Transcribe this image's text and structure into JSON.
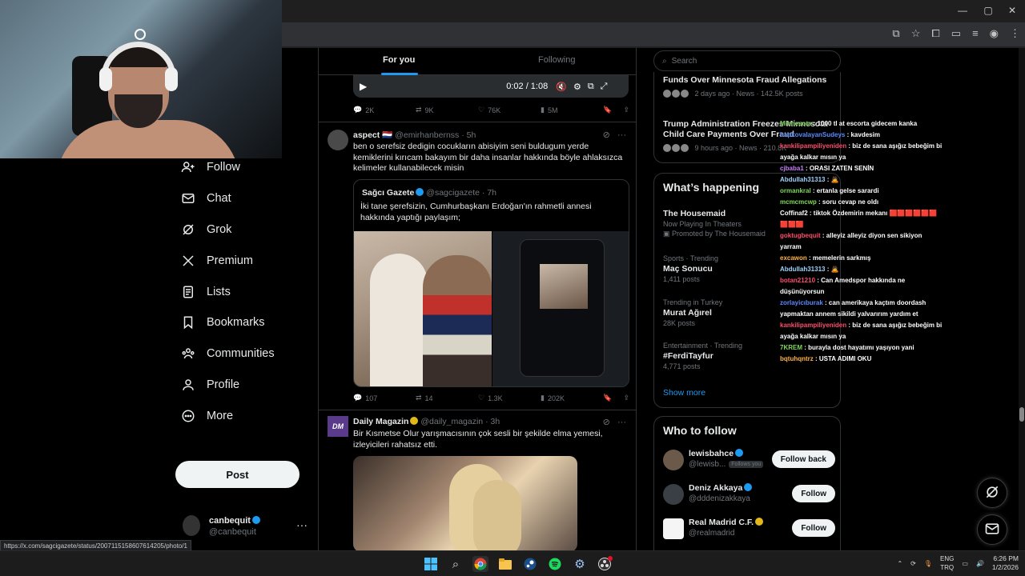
{
  "browser": {
    "title_icons": [
      "minimize-icon",
      "maximize-icon",
      "close-icon"
    ]
  },
  "status_url": "https://x.com/sagcigazete/status/2007115158607614205/photo/1",
  "sidebar": {
    "items": [
      {
        "label": "Follow",
        "icon": "add-person-icon"
      },
      {
        "label": "Chat",
        "icon": "mail-icon"
      },
      {
        "label": "Grok",
        "icon": "grok-icon"
      },
      {
        "label": "Premium",
        "icon": "x-logo-icon"
      },
      {
        "label": "Lists",
        "icon": "list-icon"
      },
      {
        "label": "Bookmarks",
        "icon": "bookmark-icon"
      },
      {
        "label": "Communities",
        "icon": "communities-icon"
      },
      {
        "label": "Profile",
        "icon": "person-icon"
      },
      {
        "label": "More",
        "icon": "more-circle-icon"
      }
    ],
    "post_label": "Post",
    "account": {
      "name": "canbequit",
      "handle": "@canbequit"
    }
  },
  "timeline": {
    "tabs": {
      "for_you": "For you",
      "following": "Following"
    },
    "video": {
      "time": "0:02 / 1:08"
    },
    "tweet0_actions": {
      "replies": "2K",
      "reposts": "9K",
      "likes": "76K",
      "views": "5M"
    },
    "tweet1": {
      "name": "aspect",
      "flag": "🇳🇱",
      "handle": "@emirhanbernss",
      "time": "· 5h",
      "text": "ben o serefsiz dedigin cocukların abisiyim seni buldugum yerde kemiklerini kırıcam bakayım bir daha insanlar hakkında böyle ahlaksızca kelimeler kullanabilecek misin",
      "quote": {
        "name": "Sağcı Gazete",
        "handle": "@sagcigazete",
        "time": "· 7h",
        "text": "İki tane şerefsizin, Cumhurbaşkanı Erdoğan'ın rahmetli annesi hakkında yaptığı paylaşım;"
      },
      "actions": {
        "replies": "107",
        "reposts": "14",
        "likes": "1.3K",
        "views": "202K"
      }
    },
    "tweet2": {
      "avatar": "DM",
      "name": "Daily Magazin",
      "handle": "@daily_magazin",
      "time": "· 3h",
      "text": "Bir Kısmetse Olur yarışmacısının çok sesli bir şekilde elma yemesi, izleyicileri rahatsız etti."
    }
  },
  "right": {
    "search_placeholder": "Search",
    "news": [
      {
        "title": "Funds Over Minnesota Fraud Allegations",
        "meta": "2 days ago · News · 142.5K posts"
      },
      {
        "title": "Trump Administration Freezes Minnesota Child Care Payments Over Fraud",
        "meta": "9 hours ago · News · 210.8K"
      }
    ],
    "happening": {
      "title": "What’s happening",
      "trends": [
        {
          "context": "",
          "title": "The Housemaid",
          "sub": "Now Playing In Theaters",
          "promo": "Promoted by The Housemaid"
        },
        {
          "context": "Sports · Trending",
          "title": "Maç Sonucu",
          "sub": "1,411 posts"
        },
        {
          "context": "Trending in Turkey",
          "title": "Murat Ağırel",
          "sub": "28K posts"
        },
        {
          "context": "Entertainment · Trending",
          "title": "#FerdiTayfur",
          "sub": "4,771 posts"
        }
      ],
      "show_more": "Show more"
    },
    "who_to_follow": {
      "title": "Who to follow",
      "users": [
        {
          "name": "lewisbahce",
          "handle": "@lewisb...",
          "badge": "Follows you",
          "button": "Follow back"
        },
        {
          "name": "Deniz Akkaya",
          "handle": "@dddenizakkaya",
          "button": "Follow"
        },
        {
          "name": "Real Madrid C.F.",
          "handle": "@realmadrid",
          "button": "Follow"
        }
      ]
    }
  },
  "chat": [
    {
      "user": "Minnesota",
      "msg": "1000 tl at escorta gidecem kanka",
      "color": "#7ed957"
    },
    {
      "user": "hapkovalayanSudeys",
      "msg": "kavdesim",
      "color": "#5b8bff"
    },
    {
      "user": "kankilipampiliyeniden",
      "msg": "biz de sana aşığız bebeğim bi ayağa kalkar mısın ya",
      "color": "#ff4d6d"
    },
    {
      "user": "cjbaba1",
      "msg": "ORASI ZATEN SENİN",
      "color": "#c77dff"
    },
    {
      "user": "Abdullah31313",
      "msg": "🙇",
      "color": "#9fd3ff"
    },
    {
      "user": "ormankral",
      "msg": "ertanla gelse sarardi",
      "color": "#7ed957"
    },
    {
      "user": "mcmcmcwp",
      "msg": "soru cevap ne oldı",
      "color": "#7ed957"
    },
    {
      "user": "Coffinaf2",
      "msg": "tiktok Özdemirin mekanı 🟥🟥🟥🟥🟥🟥🟥🟥🟥",
      "color": "#ffffff"
    },
    {
      "user": "goktugbequit",
      "msg": "alleyiz alleyiz diyon sen sikiyon yarram",
      "color": "#ff4d6d"
    },
    {
      "user": "excawon",
      "msg": "memelerin sarkmış",
      "color": "#ffb347"
    },
    {
      "user": "Abdullah31313",
      "msg": "🙇",
      "color": "#9fd3ff"
    },
    {
      "user": "botan21210",
      "msg": "Can Amedspor hakkında ne düşünüyorsun",
      "color": "#ff4d6d"
    },
    {
      "user": "zorlayicıburak",
      "msg": "can amerikaya kaçtım doordash yapmaktan annem sikildi yalvarırım yardım et",
      "color": "#5b8bff"
    },
    {
      "user": "kankilipampiliyeniden",
      "msg": "biz de sana aşığız bebeğim bi ayağa kalkar mısın ya",
      "color": "#ff4d6d"
    },
    {
      "user": "7KREM",
      "msg": "burayla dost hayatımı yaşıyon yani",
      "color": "#7ed957"
    },
    {
      "user": "bqtuhqntrz",
      "msg": "USTA ADIMI OKU",
      "color": "#ffb347"
    }
  ],
  "taskbar": {
    "lang_top": "ENG",
    "lang_bottom": "TRQ",
    "time": "6:26 PM",
    "date": "1/2/2026"
  }
}
